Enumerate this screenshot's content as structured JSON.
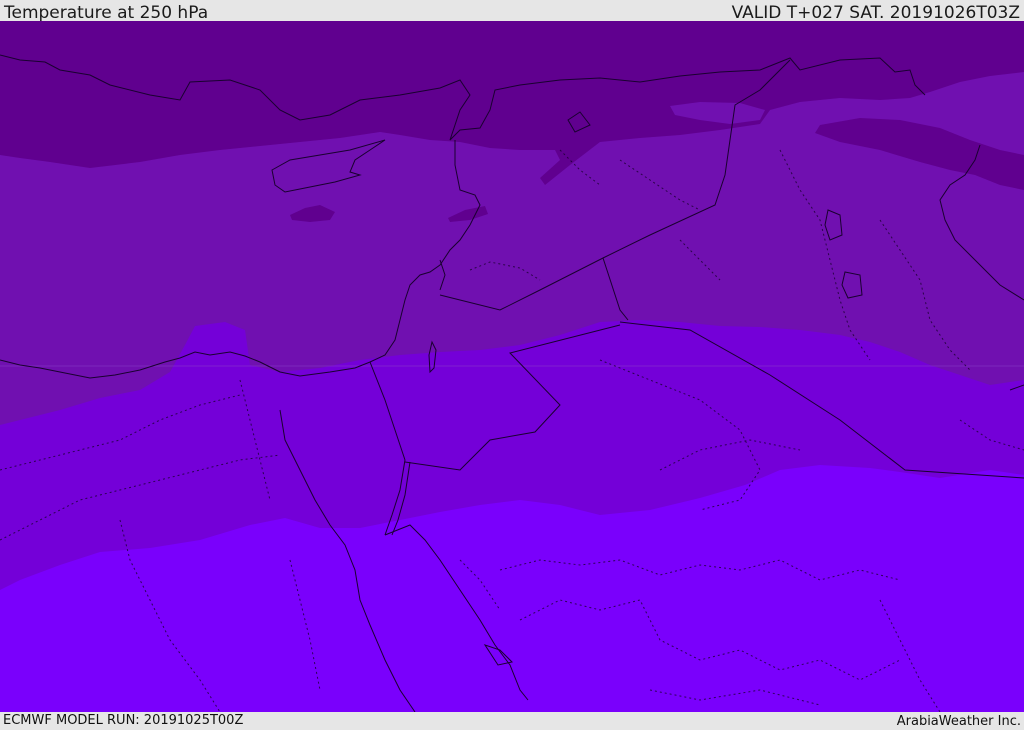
{
  "header": {
    "title": "Temperature at 250 hPa",
    "valid": "VALID T+027 SAT. 20191026T03Z"
  },
  "footer": {
    "model_run": "ECMWF MODEL RUN: 20191025T00Z",
    "credit": "ArabiaWeather Inc."
  },
  "colors": {
    "band_darkest": "#60008f",
    "band_dark": "#7010b0",
    "band_mid": "#7400d8",
    "band_light": "#7a00fc",
    "border_line": "#1a0030"
  }
}
